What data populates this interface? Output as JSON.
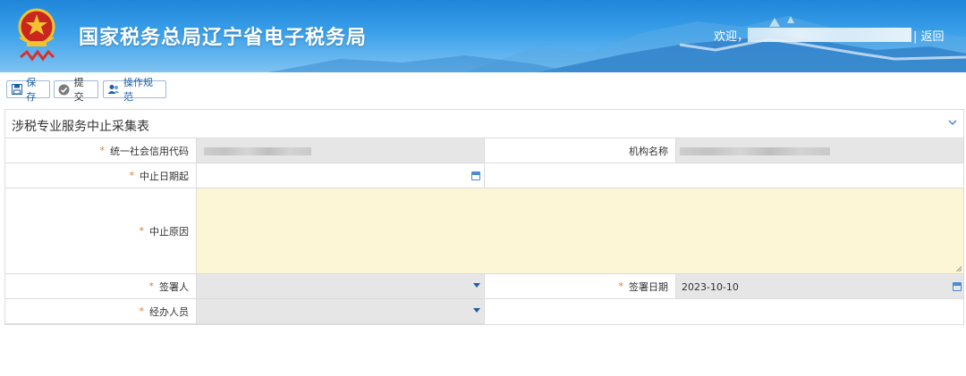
{
  "header": {
    "site_title": "国家税务总局辽宁省电子税务局",
    "welcome": "欢迎，",
    "return_link": "| 返回"
  },
  "toolbar": {
    "save_label": "保存",
    "submit_label": "提交",
    "guide_label": "操作规范"
  },
  "form": {
    "title": "涉税专业服务中止采集表",
    "required_mark": "*",
    "fields": {
      "credit_code_label": "统一社会信用代码",
      "org_name_label": "机构名称",
      "suspend_start_label": "中止日期起",
      "suspend_reason_label": "中止原因",
      "signer_label": "签署人",
      "sign_date_label": "签署日期",
      "sign_date_value": "2023-10-10",
      "handler_label": "经办人员"
    }
  },
  "colors": {
    "header_blue": "#2a8fe0",
    "required_asterisk": "#e07a2e",
    "textarea_yellow": "#fcf6d7",
    "readonly_gray": "#e6e6e6",
    "accent_blue": "#1b5ea6"
  }
}
